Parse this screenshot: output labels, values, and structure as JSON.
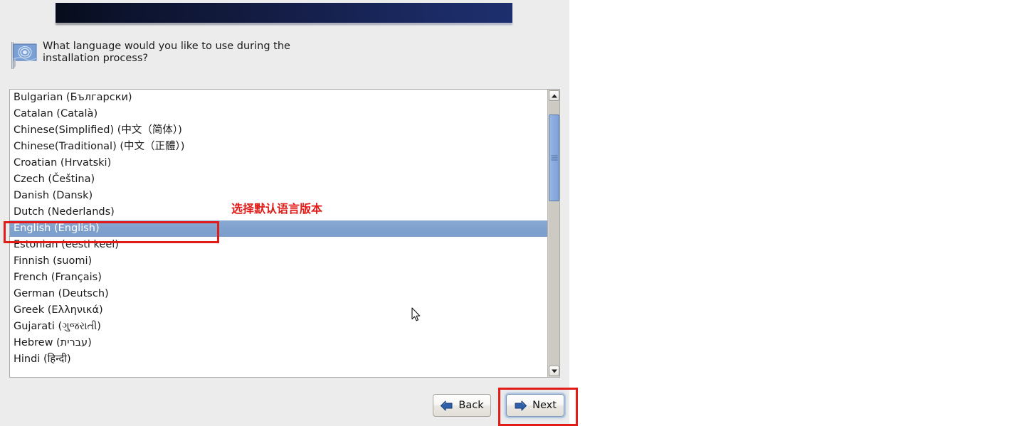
{
  "window": {
    "question": "What language would you like to use during the\ninstallation process?",
    "flag_icon": "un-flag-icon"
  },
  "language_list": {
    "items": [
      "Bulgarian (Български)",
      "Catalan (Català)",
      "Chinese(Simplified) (中文（简体）)",
      "Chinese(Traditional) (中文（正體）)",
      "Croatian (Hrvatski)",
      "Czech (Čeština)",
      "Danish (Dansk)",
      "Dutch (Nederlands)",
      "English (English)",
      "Estonian (eesti keel)",
      "Finnish (suomi)",
      "French (Français)",
      "German (Deutsch)",
      "Greek (Ελληνικά)",
      "Gujarati (ગુજરાતી)",
      "Hebrew (עברית)",
      "Hindi (हिन्दी)"
    ],
    "selected_index": 8,
    "selected_value": "English (English)",
    "selection_color": "#7fa1cd"
  },
  "scrollbar": {
    "up_icon": "chevron-up-icon",
    "down_icon": "chevron-down-icon",
    "thumb_color": "#8cade0"
  },
  "buttons": {
    "back": {
      "label": "Back",
      "icon": "arrow-left-icon"
    },
    "next": {
      "label": "Next",
      "icon": "arrow-right-icon",
      "focused": true
    }
  },
  "annotations": {
    "note_text": "选择默认语言版本",
    "note_color": "#e01b18",
    "box_color": "#e01b18"
  }
}
